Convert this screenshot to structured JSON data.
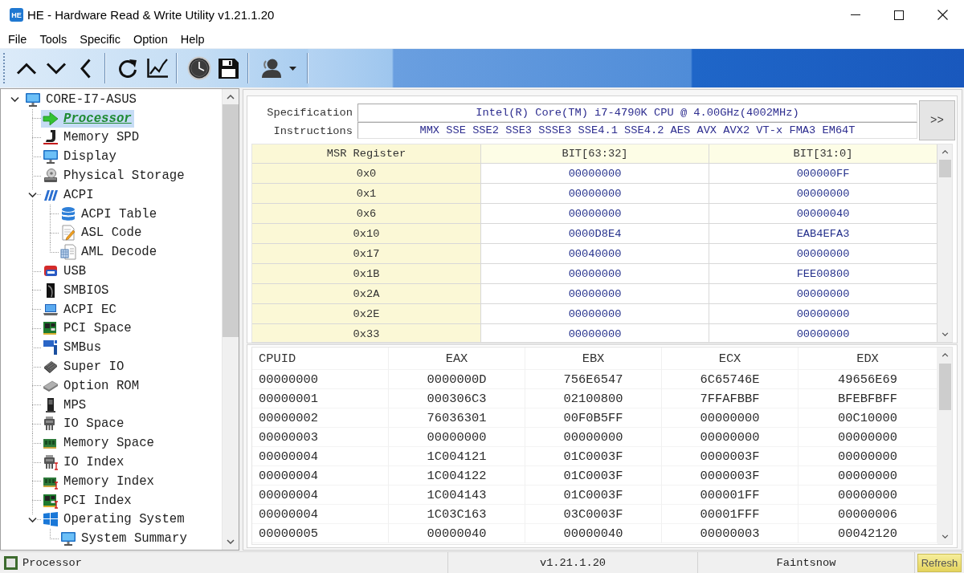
{
  "window": {
    "icon_label": "HE",
    "title": "HE - Hardware Read & Write Utility v1.21.1.20"
  },
  "menu": [
    "File",
    "Tools",
    "Specific",
    "Option",
    "Help"
  ],
  "tree": {
    "items": [
      {
        "label": "CORE-I7-ASUS",
        "selected": false,
        "expanded": true,
        "children": [
          {
            "label": "Processor",
            "selected": true
          },
          {
            "label": "Memory SPD",
            "selected": false
          },
          {
            "label": "Display",
            "selected": false
          },
          {
            "label": "Physical Storage",
            "selected": false
          },
          {
            "label": "ACPI",
            "selected": false,
            "expanded": true,
            "children": [
              {
                "label": "ACPI Table",
                "selected": false
              },
              {
                "label": "ASL Code",
                "selected": false
              },
              {
                "label": "AML Decode",
                "selected": false
              }
            ]
          },
          {
            "label": "USB",
            "selected": false
          },
          {
            "label": "SMBIOS",
            "selected": false
          },
          {
            "label": "ACPI EC",
            "selected": false
          },
          {
            "label": "PCI Space",
            "selected": false
          },
          {
            "label": "SMBus",
            "selected": false
          },
          {
            "label": "Super IO",
            "selected": false
          },
          {
            "label": "Option ROM",
            "selected": false
          },
          {
            "label": "MPS",
            "selected": false
          },
          {
            "label": "IO Space",
            "selected": false
          },
          {
            "label": "Memory Space",
            "selected": false
          },
          {
            "label": "IO Index",
            "selected": false
          },
          {
            "label": "Memory Index",
            "selected": false
          },
          {
            "label": "PCI Index",
            "selected": false
          },
          {
            "label": "Operating System",
            "selected": false,
            "expanded": true,
            "children": [
              {
                "label": "System Summary",
                "selected": false
              }
            ]
          }
        ]
      }
    ]
  },
  "processor": {
    "specification": {
      "label": "Specification",
      "value": "Intel(R) Core(TM) i7-4790K CPU @ 4.00GHz(4002MHz)"
    },
    "instructions": {
      "label": "Instructions",
      "value": "MMX SSE SSE2 SSE3 SSSE3 SSE4.1 SSE4.2 AES AVX AVX2 VT-x FMA3 EM64T"
    },
    "more_button": ">>",
    "msr_table": {
      "columns": [
        "MSR Register",
        "BIT[63:32]",
        "BIT[31:0]"
      ],
      "rows": [
        [
          "0x0",
          "00000000",
          "000000FF"
        ],
        [
          "0x1",
          "00000000",
          "00000000"
        ],
        [
          "0x6",
          "00000000",
          "00000040"
        ],
        [
          "0x10",
          "0000D8E4",
          "EAB4EFA3"
        ],
        [
          "0x17",
          "00040000",
          "00000000"
        ],
        [
          "0x1B",
          "00000000",
          "FEE00800"
        ],
        [
          "0x2A",
          "00000000",
          "00000000"
        ],
        [
          "0x2E",
          "00000000",
          "00000000"
        ],
        [
          "0x33",
          "00000000",
          "00000000"
        ]
      ]
    },
    "cpuid_table": {
      "columns": [
        "CPUID",
        "EAX",
        "EBX",
        "ECX",
        "EDX"
      ],
      "rows": [
        [
          "00000000",
          "0000000D",
          "756E6547",
          "6C65746E",
          "49656E69"
        ],
        [
          "00000001",
          "000306C3",
          "02100800",
          "7FFAFBBF",
          "BFEBFBFF"
        ],
        [
          "00000002",
          "76036301",
          "00F0B5FF",
          "00000000",
          "00C10000"
        ],
        [
          "00000003",
          "00000000",
          "00000000",
          "00000000",
          "00000000"
        ],
        [
          "00000004",
          "1C004121",
          "01C0003F",
          "0000003F",
          "00000000"
        ],
        [
          "00000004",
          "1C004122",
          "01C0003F",
          "0000003F",
          "00000000"
        ],
        [
          "00000004",
          "1C004143",
          "01C0003F",
          "000001FF",
          "00000000"
        ],
        [
          "00000004",
          "1C03C163",
          "03C0003F",
          "00001FFF",
          "00000006"
        ],
        [
          "00000005",
          "00000040",
          "00000040",
          "00000003",
          "00042120"
        ]
      ]
    }
  },
  "status_bar": {
    "panels": [
      {
        "kind": "page",
        "text": "Processor"
      },
      {
        "kind": "plain",
        "text": "v1.21.1.20"
      },
      {
        "kind": "plain",
        "text": "Faintsnow"
      },
      {
        "kind": "button",
        "text": "Refresh"
      }
    ]
  }
}
